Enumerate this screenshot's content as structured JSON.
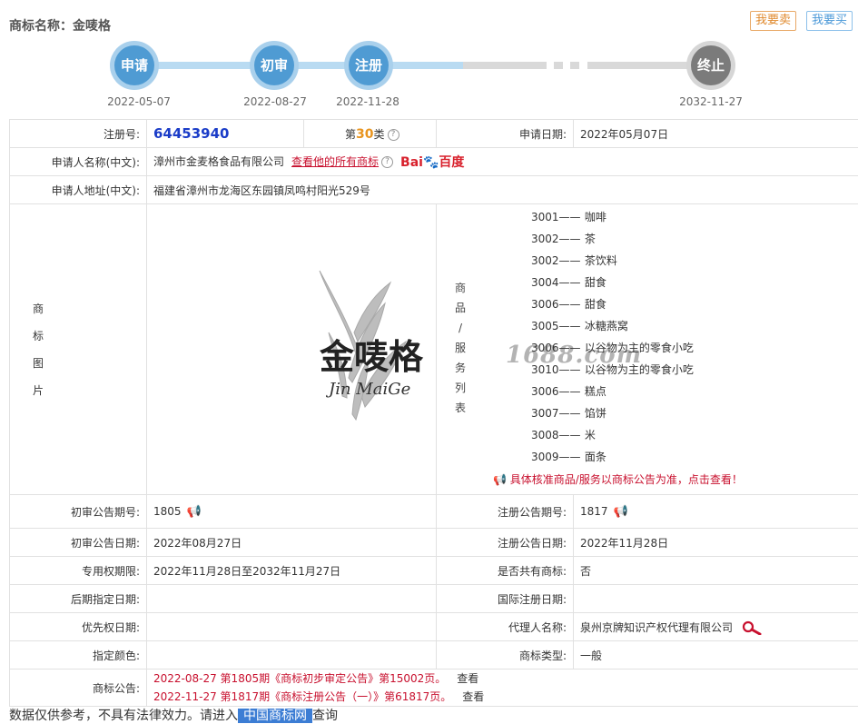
{
  "header": {
    "title": "商标名称：金唛格",
    "sell_button": "我要卖",
    "buy_button": "我要买"
  },
  "timeline": [
    {
      "label": "申请",
      "date": "2022-05-07"
    },
    {
      "label": "初审",
      "date": "2022-08-27"
    },
    {
      "label": "注册",
      "date": "2022-11-28"
    },
    {
      "label": "终止",
      "date": "2032-11-27"
    }
  ],
  "info": {
    "reg_no_label": "注册号:",
    "reg_no": "64453940",
    "class_prefix": "第",
    "class_num": "30",
    "class_suffix": "类",
    "apply_date_label": "申请日期:",
    "apply_date": "2022年05月07日",
    "applicant_label": "申请人名称(中文):",
    "applicant": "漳州市金麦格食品有限公司",
    "all_marks_link": "查看他的所有商标",
    "baidu_text": "Bai",
    "baidu_paw": "🐾",
    "baidu_cn": "百度",
    "address_label": "申请人地址(中文):",
    "address": "福建省漳州市龙海区东园镇凤鸣村阳光529号",
    "logo_label_chars": [
      "商",
      "标",
      "图",
      "片"
    ],
    "logo_cn": "金唛格",
    "logo_en": "Jin MaiGe",
    "watermark": "1688.com",
    "services_label_chars": [
      "商",
      "品",
      "/",
      "服",
      "务",
      "列",
      "表"
    ],
    "services": [
      {
        "code": "3001——",
        "name": "咖啡"
      },
      {
        "code": "3002——",
        "name": "茶"
      },
      {
        "code": "3002——",
        "name": "茶饮料"
      },
      {
        "code": "3004——",
        "name": "甜食"
      },
      {
        "code": "3006——",
        "name": "甜食"
      },
      {
        "code": "3005——",
        "name": "冰糖燕窝"
      },
      {
        "code": "3006——",
        "name": "以谷物为主的零食小吃"
      },
      {
        "code": "3010——",
        "name": "以谷物为主的零食小吃"
      },
      {
        "code": "3006——",
        "name": "糕点"
      },
      {
        "code": "3007——",
        "name": "馅饼"
      },
      {
        "code": "3008——",
        "name": "米"
      },
      {
        "code": "3009——",
        "name": "面条"
      }
    ],
    "services_note": "具体核准商品/服务以商标公告为准，点击查看！",
    "prelim_no_label": "初审公告期号:",
    "prelim_no": "1805",
    "reg_pub_no_label": "注册公告期号:",
    "reg_pub_no": "1817",
    "prelim_date_label": "初审公告日期:",
    "prelim_date": "2022年08月27日",
    "reg_pub_date_label": "注册公告日期:",
    "reg_pub_date": "2022年11月28日",
    "exclusive_label": "专用权期限:",
    "exclusive": "2022年11月28日至2032年11月27日",
    "shared_label": "是否共有商标:",
    "shared": "否",
    "later_date_label": "后期指定日期:",
    "later_date": "",
    "intl_date_label": "国际注册日期:",
    "intl_date": "",
    "priority_label": "优先权日期:",
    "priority": "",
    "agent_label": "代理人名称:",
    "agent": "泉州京牌知识产权代理有限公司",
    "color_label": "指定颜色:",
    "color": "",
    "type_label": "商标类型:",
    "type": "一般",
    "notice_label": "商标公告:",
    "notices": [
      {
        "text": "2022-08-27 第1805期《商标初步审定公告》第15002页。",
        "view": "查看"
      },
      {
        "text": "2022-11-27 第1817期《商标注册公告（一）》第61817页。",
        "view": "查看"
      }
    ]
  },
  "footer": {
    "text": "数据仅供参考，不具有法律效力。请进入",
    "highlight": "中国商标网",
    "rest": "查询"
  },
  "colors": {
    "accent_blue": "#4f9bd3",
    "red": "#c8102e",
    "orange": "#e8941e"
  }
}
